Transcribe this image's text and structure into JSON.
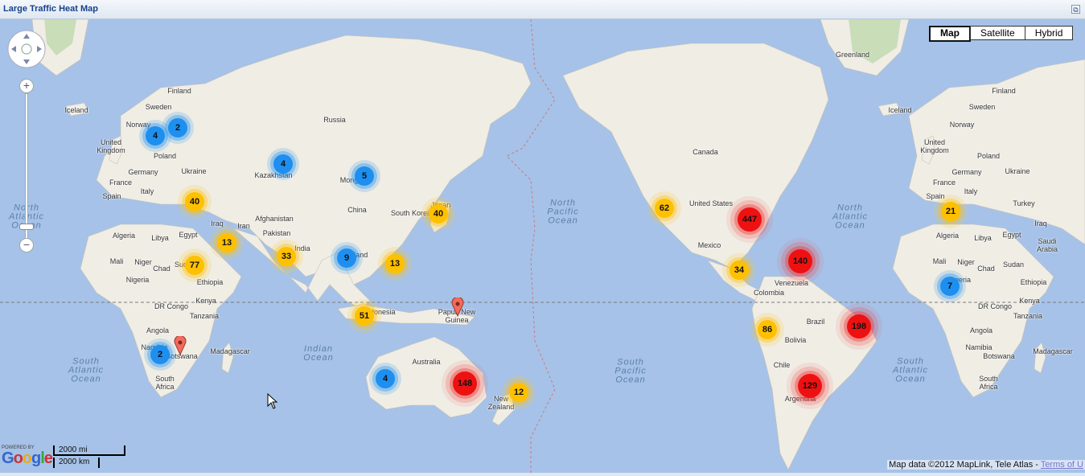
{
  "window": {
    "title": "Large Traffic Heat Map",
    "restore_icon": "restore-icon"
  },
  "map_type": {
    "options": [
      "Map",
      "Satellite",
      "Hybrid"
    ],
    "selected": "Map"
  },
  "controls": {
    "zoom_in": "+",
    "zoom_out": "−",
    "zoom_level_fraction": 0.9
  },
  "scale": {
    "imperial": "2000 mi",
    "metric": "2000 km"
  },
  "branding": {
    "powered_by": "POWERED BY",
    "logo": "Google"
  },
  "copyright": {
    "text": "Map data ©2012 MapLink, Tele Atlas - ",
    "terms_link": "Terms of U"
  },
  "oceans": [
    {
      "id": "atlantic-w",
      "text": "North\nAtlantic\nOcean"
    },
    {
      "id": "south-atl-w",
      "text": "South\nAtlantic\nOcean"
    },
    {
      "id": "indian",
      "text": "Indian\nOcean"
    },
    {
      "id": "n-pacific",
      "text": "North\nPacific\nOcean"
    },
    {
      "id": "s-pacific",
      "text": "South\nPacific\nOcean"
    },
    {
      "id": "n-atlantic-e",
      "text": "North\nAtlantic\nOcean"
    },
    {
      "id": "s-atlantic-e",
      "text": "South\nAtlantic\nOcean"
    }
  ],
  "labels": {
    "iceland": "Iceland",
    "finland": "Finland",
    "sweden": "Sweden",
    "norway": "Norway",
    "uk": "United\nKingdom",
    "poland": "Poland",
    "germany": "Germany",
    "ukraine": "Ukraine",
    "france": "France",
    "italy": "Italy",
    "spain": "Spain",
    "russia": "Russia",
    "kazakhstan": "Kazakhstan",
    "mongolia": "Mong",
    "china": "China",
    "japan": "Japan",
    "south_korea": "South Korea",
    "afghanistan": "Afghanistan",
    "iran": "Iran",
    "iraq": "Iraq",
    "pakistan": "Pakistan",
    "india": "India",
    "thailand": "Thailand",
    "indonesia": "Indonesia",
    "papua": "Papua New\nGuinea",
    "australia": "Australia",
    "new_zealand": "New\nZealand",
    "algeria": "Algeria",
    "libya": "Libya",
    "egypt": "Egypt",
    "mali": "Mali",
    "niger": "Niger",
    "chad": "Chad",
    "sudan": "Sudan",
    "nigeria": "Nigeria",
    "ethiopia": "Ethiopia",
    "dr_congo": "DR Congo",
    "kenya": "Kenya",
    "tanzania": "Tanzania",
    "angola": "Angola",
    "namibia": "Namibia",
    "botswana": "Botswana",
    "south_africa": "South\nAfrica",
    "madagascar": "Madagascar",
    "greenland": "Greenland",
    "canada": "Canada",
    "united_states": "United States",
    "mexico": "Mexico",
    "venezuela": "Venezuela",
    "colombia": "Colombia",
    "brazil": "Brazil",
    "bolivia": "Bolivia",
    "chile": "Chile",
    "argentina": "Argentina",
    "iceland2": "Iceland",
    "finland2": "Finland",
    "sweden2": "Sweden",
    "norway2": "Norway",
    "uk2": "United\nKingdom",
    "poland2": "Poland",
    "germany2": "Germany",
    "ukraine2": "Ukraine",
    "france2": "France",
    "italy2": "Italy",
    "spain2": "Spain",
    "turkey2": "Turkey",
    "iraq2": "Iraq",
    "algeria2": "Algeria",
    "libya2": "Libya",
    "egypt2": "Egypt",
    "saudi2": "Saudi\nArabia",
    "mali2": "Mali",
    "niger2": "Niger",
    "chad2": "Chad",
    "sudan2": "Sudan",
    "nigeria2": "geria",
    "ethiopia2": "Ethiopia",
    "drcongo2": "DR Congo",
    "kenya2": "Kenya",
    "tanzania2": "Tanzania",
    "angola2": "Angola",
    "namibia2": "Namibia",
    "botswana2": "Botswana",
    "southafrica2": "South\nAfrica",
    "madagascar2": "Madagascar"
  },
  "clusters": [
    {
      "value": "4",
      "level": "blue"
    },
    {
      "value": "2",
      "level": "blue"
    },
    {
      "value": "4",
      "level": "blue"
    },
    {
      "value": "5",
      "level": "blue"
    },
    {
      "value": "40",
      "level": "yellow"
    },
    {
      "value": "40",
      "level": "yellow"
    },
    {
      "value": "13",
      "level": "yellow"
    },
    {
      "value": "77",
      "level": "yellow"
    },
    {
      "value": "33",
      "level": "yellow"
    },
    {
      "value": "9",
      "level": "blue"
    },
    {
      "value": "13",
      "level": "yellow"
    },
    {
      "value": "51",
      "level": "yellow"
    },
    {
      "value": "2",
      "level": "blue"
    },
    {
      "value": "4",
      "level": "blue"
    },
    {
      "value": "148",
      "level": "red"
    },
    {
      "value": "12",
      "level": "yellow"
    },
    {
      "value": "62",
      "level": "yellow"
    },
    {
      "value": "447",
      "level": "red"
    },
    {
      "value": "34",
      "level": "yellow"
    },
    {
      "value": "140",
      "level": "red"
    },
    {
      "value": "86",
      "level": "yellow"
    },
    {
      "value": "198",
      "level": "red"
    },
    {
      "value": "129",
      "level": "red"
    },
    {
      "value": "21",
      "level": "yellow"
    },
    {
      "value": "7",
      "level": "blue"
    }
  ],
  "colors": {
    "blue": "#1d8ff0",
    "yellow": "#ffc000",
    "red": "#ee1111",
    "water": "#a6c2e8",
    "land": "#f0ede5"
  }
}
